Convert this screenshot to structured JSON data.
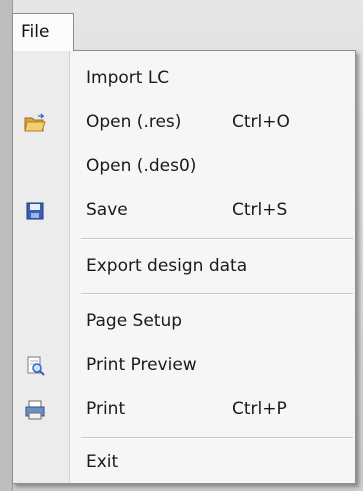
{
  "menu": {
    "title": "File",
    "items": [
      {
        "label": "Import LC",
        "shortcut": "",
        "icon": ""
      },
      {
        "label": "Open (.res)",
        "shortcut": "Ctrl+O",
        "icon": "open-folder-icon"
      },
      {
        "label": "Open (.des0)",
        "shortcut": "",
        "icon": ""
      },
      {
        "label": "Save",
        "shortcut": "Ctrl+S",
        "icon": "save-disk-icon"
      },
      {
        "label": "Export design data",
        "shortcut": "",
        "icon": ""
      },
      {
        "label": "Page Setup",
        "shortcut": "",
        "icon": ""
      },
      {
        "label": "Print Preview",
        "shortcut": "",
        "icon": "print-preview-icon"
      },
      {
        "label": "Print",
        "shortcut": "Ctrl+P",
        "icon": "printer-icon"
      },
      {
        "label": "Exit",
        "shortcut": "",
        "icon": ""
      }
    ]
  }
}
